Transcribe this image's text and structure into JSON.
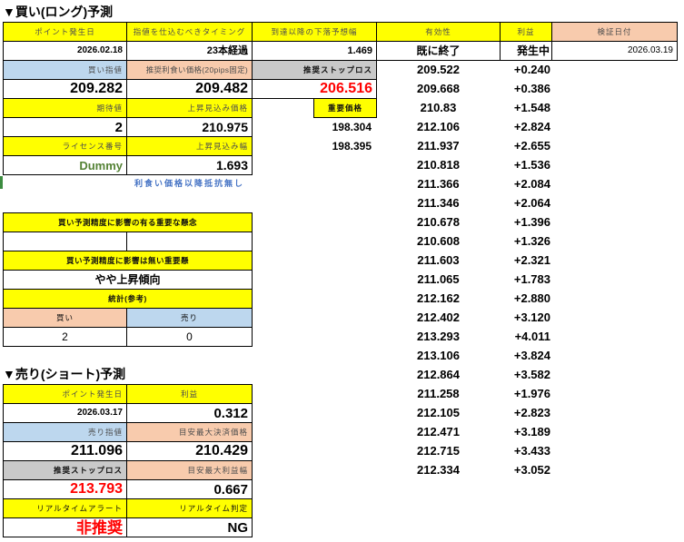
{
  "colors": {
    "header_yellow": "#ffff00",
    "salmon": "#f8cbad",
    "light_blue": "#bdd7ee",
    "gray": "#c9c9c9",
    "alert_red": "#ff0000",
    "license_green": "#548235",
    "note_blue": "#4472c4",
    "marker_green": "#3c8c40"
  },
  "buy_section": {
    "title": "▼買い(ロング)予測",
    "headers": {
      "point_date": "ポイント発生日",
      "timing": "指値を仕込むべきタイミング",
      "drop_range": "到達以降の下落予想幅",
      "validity": "有効性",
      "profit": "利益",
      "verify_date": "検証日付"
    },
    "summary": {
      "point_date": "2026.02.18",
      "timing": "23本経過",
      "drop_range": "1.469",
      "validity": "既に終了",
      "profit": "発生中",
      "verify_date": "2026.03.19"
    },
    "prices": {
      "buy_limit_label": "買い指値",
      "take_profit_label": "推奨利食い価格(20pips固定)",
      "stop_loss_label": "推奨ストップロス",
      "buy_limit": "209.282",
      "take_profit": "209.482",
      "stop_loss": "206.516"
    },
    "outlook": {
      "expected_value_label": "期待値",
      "rise_price_label": "上昇見込み価格",
      "key_price_label": "重要価格",
      "expected_value": "2",
      "rise_price": "210.975",
      "key_prices": [
        "198.304",
        "198.395"
      ],
      "license_label": "ライセンス番号",
      "rise_range_label": "上昇見込み幅",
      "license": "Dummy",
      "rise_range": "1.693",
      "note": "利食い価格以降抵抗無し"
    },
    "concerns": {
      "critical_label": "買い予測精度に影響の有る重要な懸念",
      "noncritical_label": "買い予測精度に影響は無い重要懸",
      "noncritical_value": "やや上昇傾向"
    },
    "stats": {
      "label": "統計(参考)",
      "buy_label": "買い",
      "sell_label": "売り",
      "buy_count": "2",
      "sell_count": "0"
    }
  },
  "verification": [
    {
      "price": "209.522",
      "profit": "+0.240"
    },
    {
      "price": "209.668",
      "profit": "+0.386"
    },
    {
      "price": "210.83",
      "profit": "+1.548"
    },
    {
      "price": "212.106",
      "profit": "+2.824"
    },
    {
      "price": "211.937",
      "profit": "+2.655"
    },
    {
      "price": "210.818",
      "profit": "+1.536"
    },
    {
      "price": "211.366",
      "profit": "+2.084"
    },
    {
      "price": "211.346",
      "profit": "+2.064"
    },
    {
      "price": "210.678",
      "profit": "+1.396"
    },
    {
      "price": "210.608",
      "profit": "+1.326"
    },
    {
      "price": "211.603",
      "profit": "+2.321"
    },
    {
      "price": "211.065",
      "profit": "+1.783"
    },
    {
      "price": "212.162",
      "profit": "+2.880"
    },
    {
      "price": "212.402",
      "profit": "+3.120"
    },
    {
      "price": "213.293",
      "profit": "+4.011"
    },
    {
      "price": "213.106",
      "profit": "+3.824"
    },
    {
      "price": "212.864",
      "profit": "+3.582"
    },
    {
      "price": "211.258",
      "profit": "+1.976"
    },
    {
      "price": "212.105",
      "profit": "+2.823"
    },
    {
      "price": "212.471",
      "profit": "+3.189"
    },
    {
      "price": "212.715",
      "profit": "+3.433"
    },
    {
      "price": "212.334",
      "profit": "+3.052"
    }
  ],
  "sell_section": {
    "title": "▼売り(ショート)予測",
    "point_date_label": "ポイント発生日",
    "profit_label": "利益",
    "point_date": "2026.03.17",
    "profit": "0.312",
    "sell_limit_label": "売り指値",
    "max_exit_label": "目安最大決済価格",
    "sell_limit": "211.096",
    "max_exit": "210.429",
    "stop_loss_label": "推奨ストップロス",
    "max_profit_label": "目安最大利益幅",
    "stop_loss": "213.793",
    "max_profit": "0.667",
    "alert_label": "リアルタイムアラート",
    "judgement_label": "リアルタイム判定",
    "alert": "非推奨",
    "judgement": "NG"
  }
}
